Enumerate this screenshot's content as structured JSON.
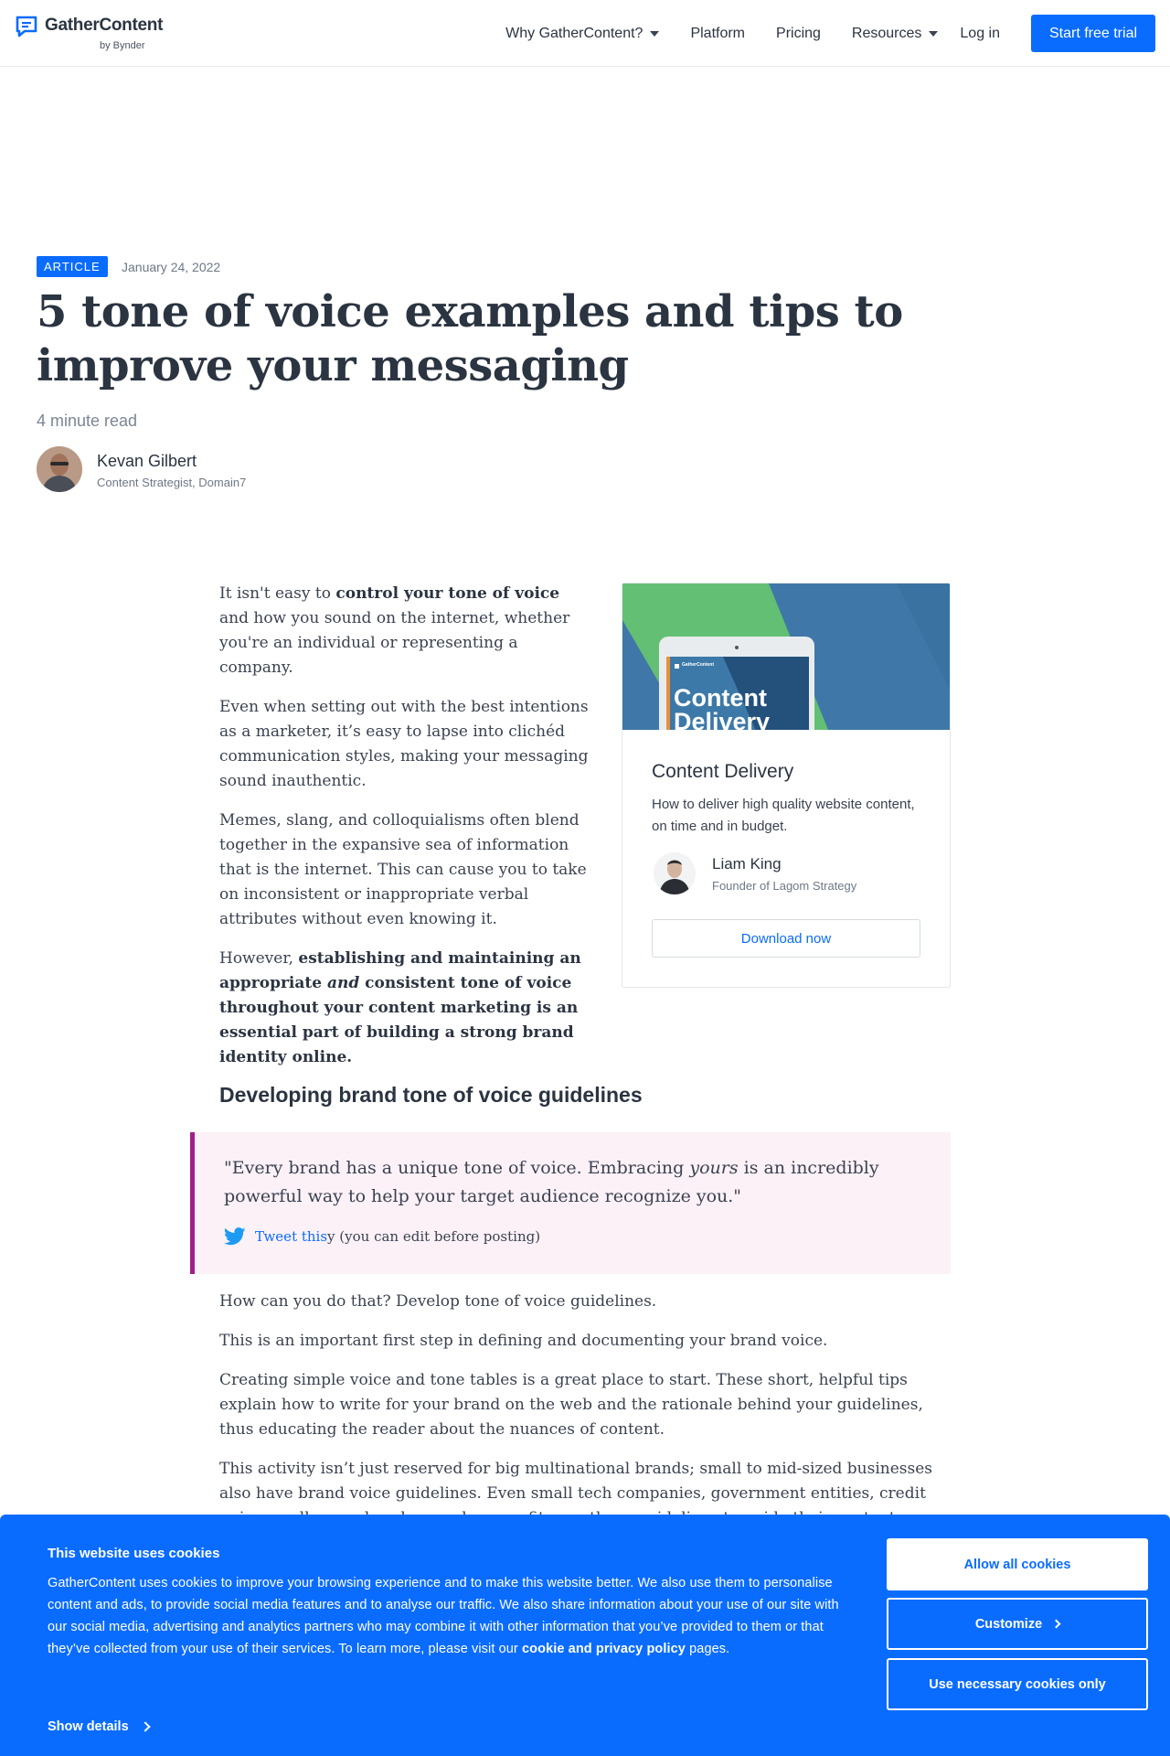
{
  "header": {
    "logo_text": "GatherContent",
    "logo_sub": "by Bynder",
    "nav": {
      "why": "Why GatherContent?",
      "platform": "Platform",
      "pricing": "Pricing",
      "resources": "Resources",
      "login": "Log in",
      "cta": "Start free trial"
    }
  },
  "hero": {
    "badge": "ARTICLE",
    "date": "January 24, 2022",
    "title": "5 tone of voice examples and tips to improve your messaging",
    "read_time": "4 minute read",
    "author": {
      "name": "Kevan Gilbert",
      "role": "Content Strategist, Domain7"
    }
  },
  "intro": {
    "p1_a": "It isn't easy to ",
    "p1_b": "control your tone of voice",
    "p1_c": " and how you sound on the internet, whether you're an individual or representing a company.",
    "p2": "Even when setting out with the best intentions as a marketer, it’s easy to lapse into clichéd communication styles, making your messaging sound inauthentic.",
    "p3": "Memes, slang, and colloquialisms often blend together in the expansive sea of information that is the internet. This can cause you to take on inconsistent or inappropriate verbal attributes without even knowing it.",
    "p4_a": "However, ",
    "p4_b": "establishing and maintaining an appropriate ",
    "p4_c": "and",
    "p4_d": " consistent tone of voice throughout your content marketing is an essential part of building a strong brand identity online."
  },
  "card": {
    "image_text": "Content Delivery",
    "image_logo": "GatherContent",
    "title": "Content Delivery",
    "description": "How to deliver high quality website content, on time and in budget.",
    "person": "Liam King",
    "person_role": "Founder of Lagom Strategy",
    "button": "Download now"
  },
  "section": {
    "heading": "Developing brand tone of voice guidelines",
    "quote_a": "\"Every brand has a unique tone of voice. Embracing ",
    "quote_b": "yours",
    "quote_c": " is an incredibly powerful way to help your target audience recognize you.\"",
    "tweet_link": "Tweet this",
    "tweet_rest": "y (you can edit before posting)",
    "p1": "How can you do that? Develop tone of voice guidelines.",
    "p2": "This is an important first step in defining and documenting your brand voice.",
    "p3": "Creating simple voice and tone tables is a great place to start. These short, helpful tips explain how to write for your brand on the web and the rationale behind your guidelines, thus educating the reader about the nuances of content.",
    "p4": "This activity isn’t just reserved for big multinational brands; small to mid-sized businesses also have brand voice guidelines. Even small tech companies, government entities, credit unions, colleges, churches, and nonprofits use these guidelines to guide their content."
  },
  "cookie": {
    "title": "This website uses cookies",
    "text": "GatherContent uses cookies to improve your browsing experience and to make this website better. We also use them to personalise content and ads, to provide social media features and to analyse our traffic. We also share information about your use of our site with our social media, advertising and analytics partners who may combine it with other information that you’ve provided to them or that they’ve collected from your use of their services. To learn more, please visit our ",
    "policy_link": "cookie and privacy policy",
    "text_end": " pages.",
    "show_details": "Show details",
    "allow_all": "Allow all cookies",
    "customize": "Customize",
    "necessary_only": "Use necessary cookies only"
  },
  "colors": {
    "brand_blue": "#0a6cff",
    "quote_accent": "#a11f8a",
    "quote_bg": "#fdf1f8",
    "text_dark": "#2b3441"
  }
}
